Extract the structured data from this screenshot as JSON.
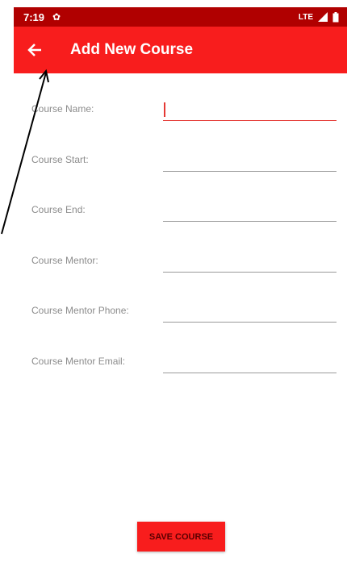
{
  "status_bar": {
    "time": "7:19",
    "network": "LTE"
  },
  "app_bar": {
    "title": "Add New Course"
  },
  "form": {
    "fields": [
      {
        "label": "Course Name:",
        "value": ""
      },
      {
        "label": "Course Start:",
        "value": ""
      },
      {
        "label": "Course End:",
        "value": ""
      },
      {
        "label": "Course Mentor:",
        "value": ""
      },
      {
        "label": "Course Mentor Phone:",
        "value": ""
      },
      {
        "label": "Course Mentor Email:",
        "value": ""
      }
    ]
  },
  "actions": {
    "save_label": "SAVE COURSE"
  },
  "colors": {
    "primary": "#f81d1d",
    "primary_dark": "#b00000",
    "accent": "#e53935"
  }
}
